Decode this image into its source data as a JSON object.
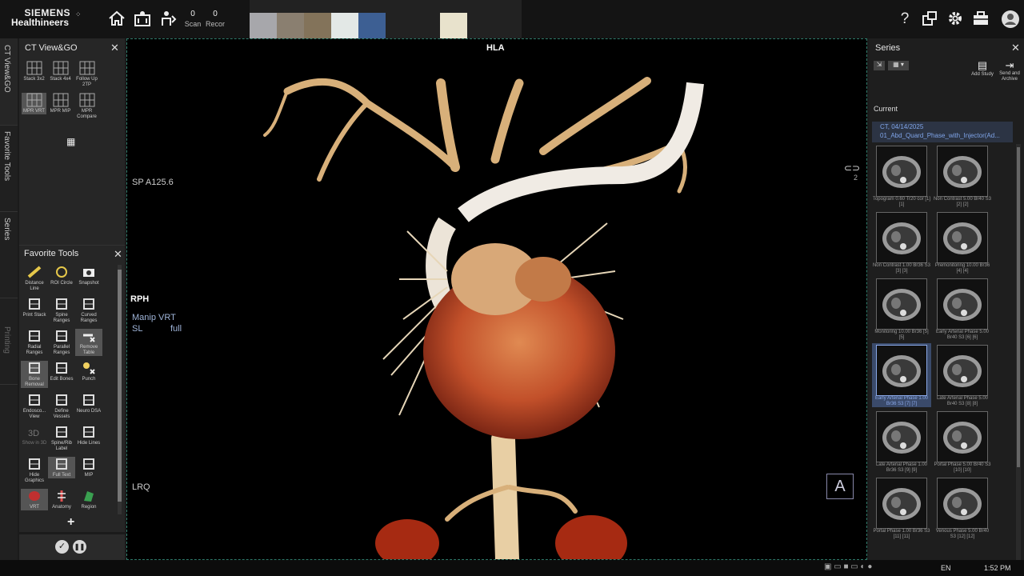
{
  "brand": {
    "line1": "SIEMENS",
    "line2": "Healthineers"
  },
  "topbar": {
    "home_icon": "home-icon",
    "scan_count": "0",
    "scan_label": "Scan",
    "recon_count": "0",
    "recon_label": "Recor",
    "help_label": "?",
    "swatches": [
      "#a7a7ab",
      "#8a7f70",
      "#83735a",
      "#e3e8e6",
      "#3d5f93",
      "#e8e2cc"
    ]
  },
  "left_tabs": [
    "CT View&GO",
    "Favorite Tools",
    "Series",
    "Printing"
  ],
  "viewgo": {
    "title": "CT View&GO",
    "layouts": [
      {
        "label": "Stack 3x2",
        "selected": false
      },
      {
        "label": "Stack 4x4",
        "selected": false
      },
      {
        "label": "Follow Up 2TP",
        "selected": false
      },
      {
        "label": "MPR VRT",
        "selected": true
      },
      {
        "label": "MPR MIP",
        "selected": false
      },
      {
        "label": "MPR Compare",
        "selected": false
      }
    ]
  },
  "favorite_tools": {
    "title": "Favorite Tools",
    "tools": [
      {
        "label": "Distance Line",
        "icon": "ruler-icon",
        "sel": false,
        "dim": false
      },
      {
        "label": "ROI Circle",
        "icon": "roi-circle-icon",
        "sel": false,
        "dim": false
      },
      {
        "label": "Snapshot",
        "icon": "camera-icon",
        "sel": false,
        "dim": false
      },
      {
        "label": "Print Stack",
        "icon": "print-stack-icon",
        "sel": false,
        "dim": false
      },
      {
        "label": "Spine Ranges",
        "icon": "spine-ranges-icon",
        "sel": false,
        "dim": false
      },
      {
        "label": "Curved Ranges",
        "icon": "curved-ranges-icon",
        "sel": false,
        "dim": false
      },
      {
        "label": "Radial Ranges",
        "icon": "radial-ranges-icon",
        "sel": false,
        "dim": false
      },
      {
        "label": "Parallel Ranges",
        "icon": "parallel-ranges-icon",
        "sel": false,
        "dim": false
      },
      {
        "label": "Remove Table",
        "icon": "remove-table-icon",
        "sel": true,
        "dim": false
      },
      {
        "label": "Bone Removal",
        "icon": "bone-removal-icon",
        "sel": true,
        "dim": false
      },
      {
        "label": "Edit Bones",
        "icon": "edit-bones-icon",
        "sel": false,
        "dim": false
      },
      {
        "label": "Punch",
        "icon": "punch-icon",
        "sel": false,
        "dim": false
      },
      {
        "label": "Endosco... View",
        "icon": "endoscopic-view-icon",
        "sel": false,
        "dim": false
      },
      {
        "label": "Define Vessels",
        "icon": "define-vessels-icon",
        "sel": false,
        "dim": false
      },
      {
        "label": "Neuro DSA",
        "icon": "neuro-dsa-icon",
        "sel": false,
        "dim": false
      },
      {
        "label": "Show in 3D",
        "icon": "3d-icon",
        "sel": false,
        "dim": true
      },
      {
        "label": "Spine/Rib Label",
        "icon": "spine-rib-label-icon",
        "sel": false,
        "dim": false
      },
      {
        "label": "Hide Lines",
        "icon": "hide-lines-icon",
        "sel": false,
        "dim": false
      },
      {
        "label": "Hide Graphics",
        "icon": "hide-graphics-icon",
        "sel": false,
        "dim": false
      },
      {
        "label": "Full Text",
        "icon": "full-text-icon",
        "sel": true,
        "dim": false
      },
      {
        "label": "MIP",
        "icon": "mip-icon",
        "sel": false,
        "dim": false
      },
      {
        "label": "VRT",
        "icon": "vrt-icon",
        "sel": true,
        "dim": false
      },
      {
        "label": "Anatomy",
        "icon": "anatomy-icon",
        "sel": false,
        "dim": false
      },
      {
        "label": "Region",
        "icon": "region-icon",
        "sel": false,
        "dim": false
      }
    ],
    "add_label": "+"
  },
  "viewport": {
    "top_label": "HLA",
    "sp": "SP A125.6",
    "orient_left": "RPH",
    "mode": "Manip VRT",
    "sl": "SL",
    "sl_value": "full",
    "orient_bottom": "LRQ",
    "link_number": "2",
    "orientation_cube": "A"
  },
  "series": {
    "title": "Series",
    "add_study": "Add Study",
    "send_archive": "Send and Archive",
    "current_label": "Current",
    "study_line1": "CT, 04/14/2025",
    "study_line2": "01_Abd_Quard_Phase_with_Injector(Ad...",
    "thumbs": [
      {
        "caption": "Topogram 0.60 Tr20 cor [1] [1]",
        "sel": false
      },
      {
        "caption": "Non Contrast 5.00 Br40 S3 [2] [2]",
        "sel": false
      },
      {
        "caption": "Non Contrast 1.00 Br36 S3 [3] [3]",
        "sel": false
      },
      {
        "caption": "Premonitoring 10.00 Br36 [4] [4]",
        "sel": false
      },
      {
        "caption": "Monitoring 10.00 Br36 [5] [5]",
        "sel": false
      },
      {
        "caption": "Early Arterial Phase 5.00 Br40 S3 [6] [6]",
        "sel": false
      },
      {
        "caption": "Early Arterial Phase 1.00 Br36 S3 [7] [7]",
        "sel": true
      },
      {
        "caption": "Late Arterial Phase 5.00 Br40 S3 [8] [8]",
        "sel": false
      },
      {
        "caption": "Late Arterial Phase 1.00 Br36 S3 [9] [9]",
        "sel": false
      },
      {
        "caption": "Portal Phase 5.00 Br40 S3 [10] [10]",
        "sel": false
      },
      {
        "caption": "Portal Phase 1.00 Br36 S3 [11] [11]",
        "sel": false
      },
      {
        "caption": "Venous Phase 5.00 Br40 S3 [12] [12]",
        "sel": false
      }
    ]
  },
  "taskbar": {
    "lang": "EN",
    "time": "1:52 PM"
  }
}
